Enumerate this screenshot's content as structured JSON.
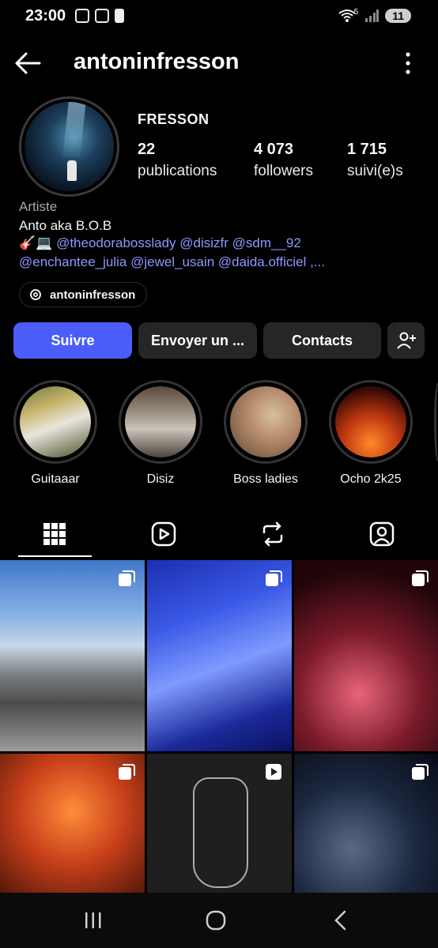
{
  "status_bar": {
    "time": "23:00",
    "battery": "11",
    "signal_label": "5"
  },
  "header": {
    "username": "antoninfresson",
    "back_icon": "arrow-left-icon",
    "more_icon": "more-vertical-icon"
  },
  "profile": {
    "display_name": "FRESSON",
    "stats": [
      {
        "value": "22",
        "label": "publications"
      },
      {
        "value": "4 073",
        "label": "followers"
      },
      {
        "value": "1 715",
        "label": "suivi(e)s"
      }
    ],
    "category": "Artiste",
    "bio_line_1": "Anto aka B.O.B",
    "bio_line_2_emoji": "🎸💻",
    "bio_line_2_mentions": "@theodorabosslady @disizfr @sdm__92",
    "bio_line_3": "@enchantee_julia @jewel_usain @daida.officiel ,...",
    "threads_handle": "antoninfresson"
  },
  "actions": {
    "follow": "Suivre",
    "message": "Envoyer un ...",
    "contacts": "Contacts",
    "add_user_icon": "add-person-icon"
  },
  "highlights": [
    {
      "label": "Guitaaar"
    },
    {
      "label": "Disiz"
    },
    {
      "label": "Boss ladies"
    },
    {
      "label": "Ocho 2k25"
    }
  ],
  "tabs": [
    {
      "name": "grid-icon"
    },
    {
      "name": "reels-icon"
    },
    {
      "name": "reposts-icon"
    },
    {
      "name": "tagged-icon"
    }
  ],
  "posts": [
    {
      "badge": "carousel-icon"
    },
    {
      "badge": "carousel-icon"
    },
    {
      "badge": "carousel-icon"
    },
    {
      "badge": "carousel-icon"
    },
    {
      "badge": "reel-icon"
    },
    {
      "badge": "carousel-icon"
    }
  ],
  "colors": {
    "accent": "#4a5df9",
    "mention": "#8e96ff",
    "button_bg": "#262626",
    "background": "#000000"
  }
}
